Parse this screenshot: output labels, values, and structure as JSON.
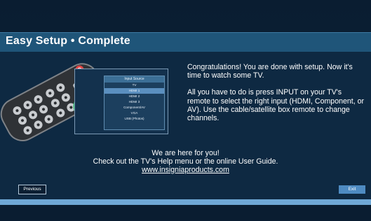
{
  "header": {
    "title": "Easy Setup • Complete"
  },
  "menu": {
    "title": "Input Source",
    "items": [
      "TV",
      "HDMI 1",
      "HDMI 2",
      "HDMI 3",
      "Component/AV",
      "VGA",
      "USB (Photos)"
    ],
    "selected_index": 1
  },
  "message": {
    "p1": "Congratulations! You are done with setup. Now it's time to watch some TV.",
    "p2": "All you have to do is press INPUT on your TV's remote to select the right input (HDMI, Component, or AV). Use the cable/satellite box remote to change channels."
  },
  "support": {
    "line1": "We are here for you!",
    "line2": "Check out the TV's Help menu or the online User Guide.",
    "link": "www.insigniaproducts.com"
  },
  "buttons": {
    "previous": "Previous",
    "exit": "Exit"
  },
  "progress": {
    "fraction": 1.0
  },
  "colors": {
    "accent": "#1f5579",
    "highlight": "#2fb86b",
    "remote_power": "#e04444"
  }
}
